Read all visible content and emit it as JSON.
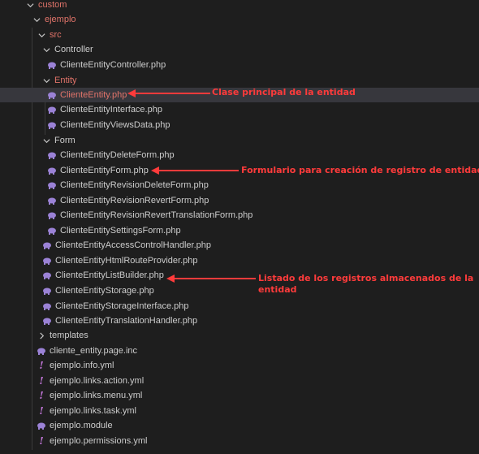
{
  "tree": {
    "custom": "custom",
    "ejemplo": "ejemplo",
    "src": "src",
    "controller_folder": "Controller",
    "controller_file": "ClienteEntityController.php",
    "entity_folder": "Entity",
    "entity_file": "ClienteEntity.php",
    "entity_interface": "ClienteEntityInterface.php",
    "entity_views": "ClienteEntityViewsData.php",
    "form_folder": "Form",
    "form_delete": "ClienteEntityDeleteForm.php",
    "form_main": "ClienteEntityForm.php",
    "form_rev_delete": "ClienteEntityRevisionDeleteForm.php",
    "form_rev_revert": "ClienteEntityRevisionRevertForm.php",
    "form_rev_revert_trans": "ClienteEntityRevisionRevertTranslationForm.php",
    "form_settings": "ClienteEntitySettingsForm.php",
    "access_handler": "ClienteEntityAccessControlHandler.php",
    "html_route": "ClienteEntityHtmlRouteProvider.php",
    "list_builder": "ClienteEntityListBuilder.php",
    "storage": "ClienteEntityStorage.php",
    "storage_interface": "ClienteEntityStorageInterface.php",
    "translation_handler": "ClienteEntityTranslationHandler.php",
    "templates": "templates",
    "page_inc": "cliente_entity.page.inc",
    "info_yml": "ejemplo.info.yml",
    "links_action": "ejemplo.links.action.yml",
    "links_menu": "ejemplo.links.menu.yml",
    "links_task": "ejemplo.links.task.yml",
    "module": "ejemplo.module",
    "permissions": "ejemplo.permissions.yml"
  },
  "annotations": {
    "entity": "Clase principal de la entidad",
    "form": "Formulario para creación de registro de entidad",
    "list_line1": "Listado de los registros almacenados de la",
    "list_line2": "entidad"
  },
  "colors": {
    "background": "#1e1e1e",
    "selected_row": "#37373d",
    "folder_accent": "#e2746a",
    "php_icon": "#9b82d6",
    "yml_icon": "#c678dd",
    "annotation": "#ff3b3b"
  }
}
